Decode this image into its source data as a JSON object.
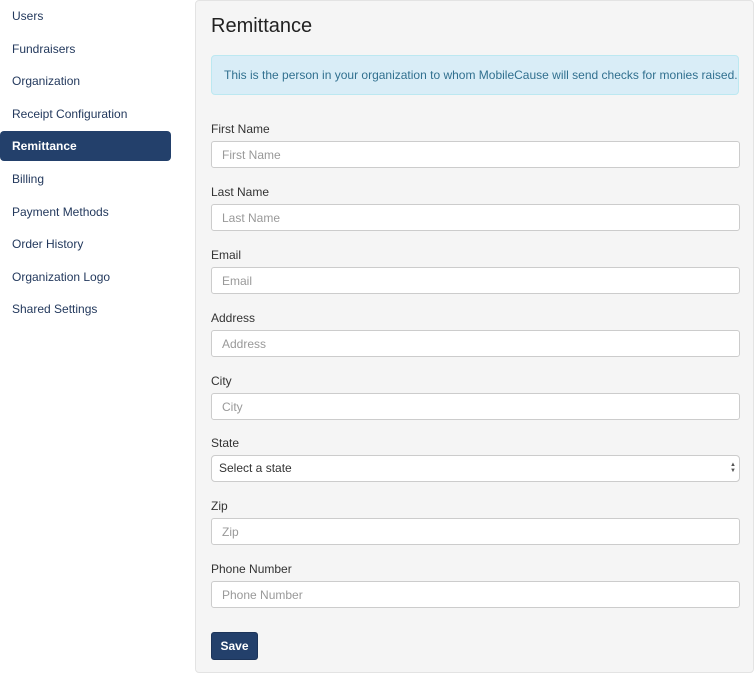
{
  "sidebar": {
    "items": [
      {
        "label": "Users",
        "active": false
      },
      {
        "label": "Fundraisers",
        "active": false
      },
      {
        "label": "Organization",
        "active": false
      },
      {
        "label": "Receipt Configuration",
        "active": false
      },
      {
        "label": "Remittance",
        "active": true
      },
      {
        "label": "Billing",
        "active": false
      },
      {
        "label": "Payment Methods",
        "active": false
      },
      {
        "label": "Order History",
        "active": false
      },
      {
        "label": "Organization Logo",
        "active": false
      },
      {
        "label": "Shared Settings",
        "active": false
      }
    ]
  },
  "main": {
    "title": "Remittance",
    "info_message": "This is the person in your organization to whom MobileCause will send checks for monies raised.",
    "fields": {
      "first_name": {
        "label": "First Name",
        "placeholder": "First Name",
        "value": ""
      },
      "last_name": {
        "label": "Last Name",
        "placeholder": "Last Name",
        "value": ""
      },
      "email": {
        "label": "Email",
        "placeholder": "Email",
        "value": ""
      },
      "address": {
        "label": "Address",
        "placeholder": "Address",
        "value": ""
      },
      "city": {
        "label": "City",
        "placeholder": "City",
        "value": ""
      },
      "state": {
        "label": "State",
        "selected": "Select a state"
      },
      "zip": {
        "label": "Zip",
        "placeholder": "Zip",
        "value": ""
      },
      "phone": {
        "label": "Phone Number",
        "placeholder": "Phone Number",
        "value": ""
      }
    },
    "save_label": "Save"
  },
  "colors": {
    "primary": "#23406b",
    "info_bg": "#d9edf7",
    "info_text": "#31708f",
    "panel_bg": "#f5f5f5"
  }
}
